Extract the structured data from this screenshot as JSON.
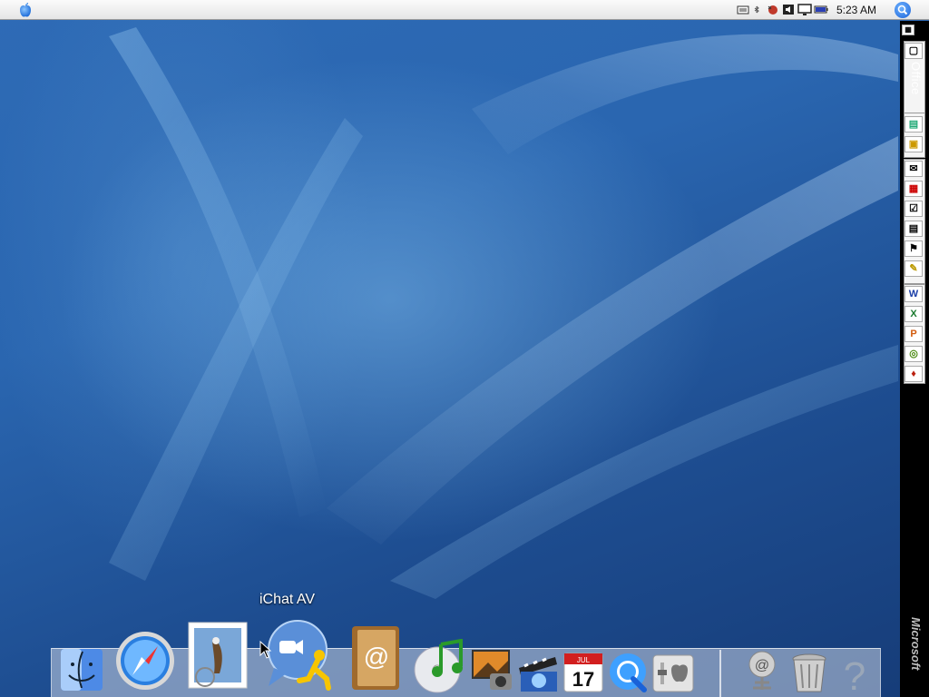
{
  "menubar": {
    "apple_icon": "apple-icon",
    "status_icons": [
      "keyboard-input-icon",
      "bluetooth-icon",
      "sync-icon",
      "volume-icon",
      "display-icon",
      "battery-icon"
    ],
    "clock": "5:23 AM",
    "spotlight_icon": "spotlight-search-icon"
  },
  "office_toolbar": {
    "title": "Office",
    "brand": "Microsoft",
    "buttons": [
      "project-gallery-icon",
      "open-file-icon",
      "mail-icon",
      "calendar-icon",
      "tasks-icon",
      "contacts-icon",
      "notes-icon",
      "project-center-icon",
      "word-icon",
      "excel-icon",
      "powerpoint-icon",
      "entourage-icon",
      "toolbox-icon"
    ]
  },
  "dock": {
    "tooltip": "iChat AV",
    "items": [
      "finder-icon",
      "safari-icon",
      "mail-icon",
      "ichat-av-icon",
      "address-book-icon",
      "itunes-icon",
      "iphoto-icon",
      "imovie-icon",
      "ical-icon",
      "quicktime-icon",
      "system-preferences-icon",
      "internet-connect-icon",
      "trash-icon",
      "help-icon"
    ],
    "ical_day": "17",
    "ical_month": "JUL"
  },
  "colors": {
    "desktop_blue": "#2a66b0",
    "office_bar": "#000000",
    "menubar": "#efefef"
  }
}
